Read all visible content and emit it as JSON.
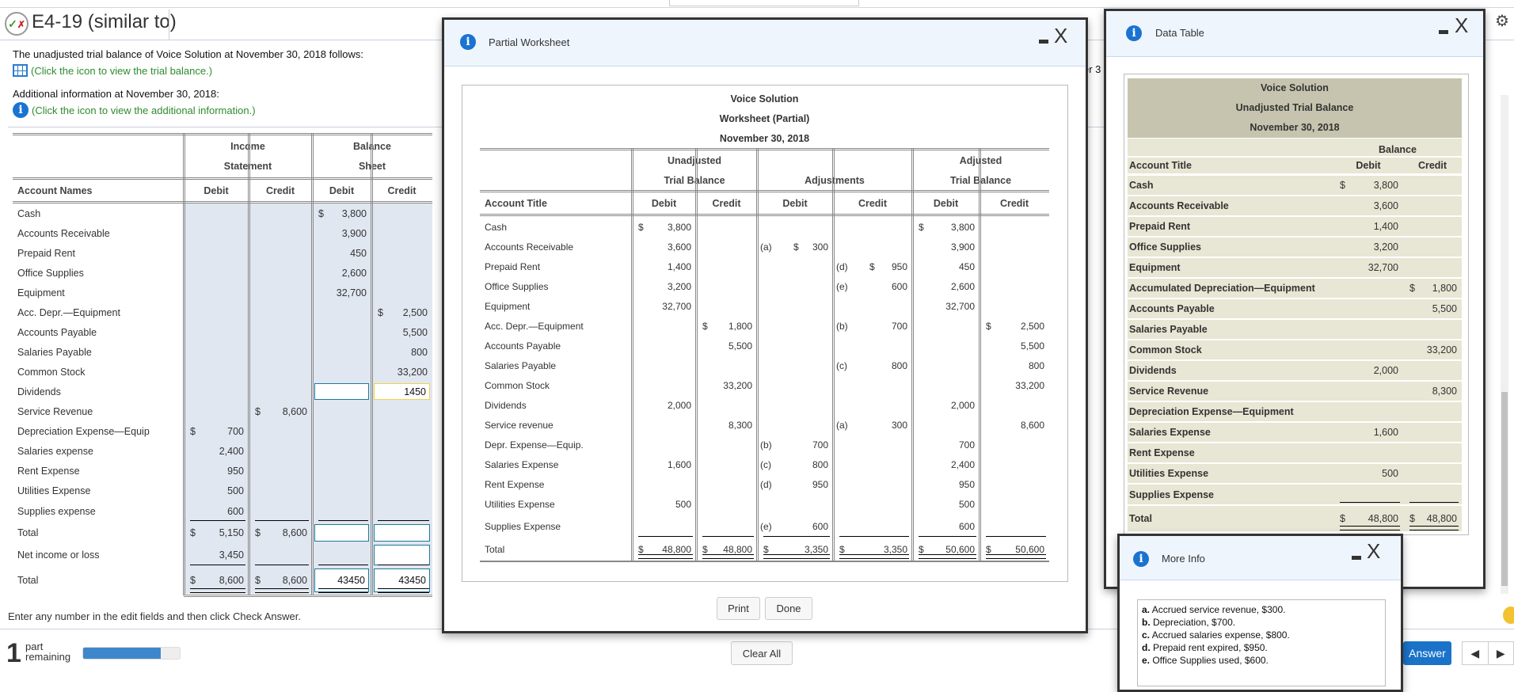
{
  "header": {
    "title": "E4-19 (similar to)",
    "status_icon": "partially-correct-icon"
  },
  "question": {
    "intro": "The unadjusted trial balance of Voice Solution at November 30, 2018 follows:",
    "trial_balance_link": "(Click the icon to view the trial balance.)",
    "additional": "Additional information at November 30, 2018:",
    "additional_link": "(Click the icon to view the additional information.)",
    "hidden_fragment": "er 3"
  },
  "left_table": {
    "group_headers": [
      "Income\nStatement",
      "Balance\nSheet"
    ],
    "columns": [
      "Account Names",
      "Debit",
      "Credit",
      "Debit",
      "Credit"
    ],
    "rows": [
      {
        "name": "Cash",
        "cells": [
          "",
          "",
          {
            "sym": "$",
            "val": "3,800"
          },
          ""
        ]
      },
      {
        "name": "Accounts Receivable",
        "cells": [
          "",
          "",
          "3,900",
          ""
        ]
      },
      {
        "name": "Prepaid Rent",
        "cells": [
          "",
          "",
          "450",
          ""
        ]
      },
      {
        "name": "Office Supplies",
        "cells": [
          "",
          "",
          "2,600",
          ""
        ]
      },
      {
        "name": "Equipment",
        "cells": [
          "",
          "",
          "32,700",
          ""
        ]
      },
      {
        "name": "Acc. Depr.—Equipment",
        "cells": [
          "",
          "",
          "",
          {
            "sym": "$",
            "val": "2,500"
          }
        ]
      },
      {
        "name": "Accounts Payable",
        "cells": [
          "",
          "",
          "",
          "5,500"
        ]
      },
      {
        "name": "Salaries Payable",
        "cells": [
          "",
          "",
          "",
          "800"
        ]
      },
      {
        "name": "Common Stock",
        "cells": [
          "",
          "",
          "",
          "33,200"
        ]
      },
      {
        "name": "Dividends",
        "cells": [
          "",
          "",
          {
            "input": ""
          },
          {
            "input": "1450",
            "state": "active"
          }
        ]
      },
      {
        "name": "Service Revenue",
        "cells": [
          "",
          {
            "sym": "$",
            "val": "8,600"
          },
          "",
          ""
        ]
      },
      {
        "name": "Depreciation Expense—Equip",
        "cells": [
          {
            "sym": "$",
            "val": "700"
          },
          "",
          "",
          ""
        ]
      },
      {
        "name": "Salaries expense",
        "cells": [
          "2,400",
          "",
          "",
          ""
        ]
      },
      {
        "name": "Rent Expense",
        "cells": [
          "950",
          "",
          "",
          ""
        ]
      },
      {
        "name": "Utilities Expense",
        "cells": [
          "500",
          "",
          "",
          ""
        ]
      },
      {
        "name": "Supplies expense",
        "cells": [
          "600",
          "",
          "",
          ""
        ]
      },
      {
        "name": "Total",
        "cells": [
          {
            "sym": "$",
            "val": "5,150"
          },
          {
            "sym": "$",
            "val": "8,600"
          },
          {
            "input": ""
          },
          {
            "input": ""
          }
        ]
      },
      {
        "name": "Net income or loss",
        "cells": [
          "3,450",
          "",
          "",
          {
            "input": ""
          }
        ]
      },
      {
        "name": "Total",
        "cells": [
          {
            "sym": "$",
            "val": "8,600"
          },
          {
            "sym": "$",
            "val": "8,600"
          },
          {
            "input": "43450"
          },
          {
            "input": "43450"
          }
        ]
      }
    ]
  },
  "instructions": "Enter any number in the edit fields and then click Check Answer.",
  "progress": {
    "parts": "1",
    "label_1": "part",
    "label_2": "remaining",
    "percent": 80
  },
  "buttons": {
    "clear_all": "Clear All",
    "check_answer": "Answer",
    "prev": "◀",
    "next": "▶"
  },
  "worksheet_modal": {
    "title": "Partial Worksheet",
    "heading": [
      "Voice Solution",
      "Worksheet (Partial)",
      "November 30, 2018"
    ],
    "group_headers": [
      "Unadjusted\nTrial Balance",
      "Adjustments",
      "Adjusted\nTrial Balance"
    ],
    "columns": [
      "Account Title",
      "Debit",
      "Credit",
      "Debit",
      "Credit",
      "Debit",
      "Credit"
    ],
    "rows": [
      {
        "name": "Cash",
        "cells": [
          {
            "sym": "$",
            "val": "3,800"
          },
          "",
          "",
          "",
          {
            "sym": "$",
            "val": "3,800"
          },
          ""
        ]
      },
      {
        "name": "Accounts Receivable",
        "cells": [
          "3,600",
          "",
          {
            "lbl": "(a)",
            "sym": "$",
            "val": "300"
          },
          "",
          "3,900",
          ""
        ]
      },
      {
        "name": "Prepaid Rent",
        "cells": [
          "1,400",
          "",
          "",
          {
            "lbl": "(d)",
            "sym": "$",
            "val": "950"
          },
          "450",
          ""
        ]
      },
      {
        "name": "Office Supplies",
        "cells": [
          "3,200",
          "",
          "",
          {
            "lbl": "(e)",
            "val": "600"
          },
          "2,600",
          ""
        ]
      },
      {
        "name": "Equipment",
        "cells": [
          "32,700",
          "",
          "",
          "",
          "32,700",
          ""
        ]
      },
      {
        "name": "Acc. Depr.—Equipment",
        "cells": [
          "",
          {
            "sym": "$",
            "val": "1,800"
          },
          "",
          {
            "lbl": "(b)",
            "val": "700"
          },
          "",
          {
            "sym": "$",
            "val": "2,500"
          }
        ]
      },
      {
        "name": "Accounts Payable",
        "cells": [
          "",
          "5,500",
          "",
          "",
          "",
          "5,500"
        ]
      },
      {
        "name": "Salaries Payable",
        "cells": [
          "",
          "",
          "",
          {
            "lbl": "(c)",
            "val": "800"
          },
          "",
          "800"
        ]
      },
      {
        "name": "Common Stock",
        "cells": [
          "",
          "33,200",
          "",
          "",
          "",
          "33,200"
        ]
      },
      {
        "name": "Dividends",
        "cells": [
          "2,000",
          "",
          "",
          "",
          "2,000",
          ""
        ]
      },
      {
        "name": "Service revenue",
        "cells": [
          "",
          "8,300",
          "",
          {
            "lbl": "(a)",
            "val": "300"
          },
          "",
          "8,600"
        ]
      },
      {
        "name": "Depr. Expense—Equip.",
        "cells": [
          "",
          "",
          {
            "lbl": "(b)",
            "val": "700"
          },
          "",
          "700",
          ""
        ]
      },
      {
        "name": "Salaries Expense",
        "cells": [
          "1,600",
          "",
          {
            "lbl": "(c)",
            "val": "800"
          },
          "",
          "2,400",
          ""
        ]
      },
      {
        "name": "Rent Expense",
        "cells": [
          "",
          "",
          {
            "lbl": "(d)",
            "val": "950"
          },
          "",
          "950",
          ""
        ]
      },
      {
        "name": "Utilities Expense",
        "cells": [
          "500",
          "",
          "",
          "",
          "500",
          ""
        ]
      },
      {
        "name": "Supplies Expense",
        "cells": [
          "",
          "",
          {
            "lbl": "(e)",
            "val": "600"
          },
          "",
          "600",
          ""
        ]
      },
      {
        "name": "Total",
        "cells": [
          {
            "sym": "$",
            "val": "48,800"
          },
          {
            "sym": "$",
            "val": "48,800"
          },
          {
            "sym": "$",
            "val": "3,350"
          },
          {
            "sym": "$",
            "val": "3,350"
          },
          {
            "sym": "$",
            "val": "50,600"
          },
          {
            "sym": "$",
            "val": "50,600"
          }
        ]
      }
    ],
    "print": "Print",
    "done": "Done"
  },
  "data_table_modal": {
    "title": "Data Table",
    "heading": [
      "Voice Solution",
      "Unadjusted Trial Balance",
      "November 30, 2018"
    ],
    "group_header": "Balance",
    "columns": [
      "Account Title",
      "Debit",
      "Credit"
    ],
    "rows": [
      {
        "name": "Cash",
        "cells": [
          {
            "sym": "$",
            "val": "3,800"
          },
          ""
        ]
      },
      {
        "name": "Accounts Receivable",
        "cells": [
          "3,600",
          ""
        ]
      },
      {
        "name": "Prepaid Rent",
        "cells": [
          "1,400",
          ""
        ]
      },
      {
        "name": "Office Supplies",
        "cells": [
          "3,200",
          ""
        ]
      },
      {
        "name": "Equipment",
        "cells": [
          "32,700",
          ""
        ]
      },
      {
        "name": "Accumulated Depreciation—Equipment",
        "cells": [
          "",
          {
            "sym": "$",
            "val": "1,800"
          }
        ]
      },
      {
        "name": "Accounts Payable",
        "cells": [
          "",
          "5,500"
        ]
      },
      {
        "name": "Salaries Payable",
        "cells": [
          "",
          ""
        ]
      },
      {
        "name": "Common Stock",
        "cells": [
          "",
          "33,200"
        ]
      },
      {
        "name": "Dividends",
        "cells": [
          "2,000",
          ""
        ]
      },
      {
        "name": "Service Revenue",
        "cells": [
          "",
          "8,300"
        ]
      },
      {
        "name": "Depreciation Expense—Equipment",
        "cells": [
          "",
          ""
        ]
      },
      {
        "name": "Salaries Expense",
        "cells": [
          "1,600",
          ""
        ]
      },
      {
        "name": "Rent Expense",
        "cells": [
          "",
          ""
        ]
      },
      {
        "name": "Utilities Expense",
        "cells": [
          "500",
          ""
        ]
      },
      {
        "name": "Supplies Expense",
        "cells": [
          "",
          ""
        ]
      },
      {
        "name": "Total",
        "cells": [
          {
            "sym": "$",
            "val": "48,800"
          },
          {
            "sym": "$",
            "val": "48,800"
          }
        ]
      }
    ]
  },
  "more_info_modal": {
    "title": "More Info",
    "items": [
      {
        "key": "a.",
        "text": " Accrued service revenue, $300."
      },
      {
        "key": "b.",
        "text": " Depreciation, $700."
      },
      {
        "key": "c.",
        "text": " Accrued salaries expense, $800."
      },
      {
        "key": "d.",
        "text": " Prepaid rent expired, $950."
      },
      {
        "key": "e.",
        "text": " Office Supplies used, $600."
      }
    ]
  },
  "modal_controls": {
    "minimize": "minimize-icon",
    "close": "X"
  },
  "colors": {
    "accent": "#1a73c8",
    "link": "#2e8b2e",
    "shade": "#e1e7f0",
    "data_table_band": "#c6c4ae",
    "data_table_row": "#e8e6d4",
    "input_border": "#1b7a9c",
    "input_active": "#f0d24a"
  }
}
